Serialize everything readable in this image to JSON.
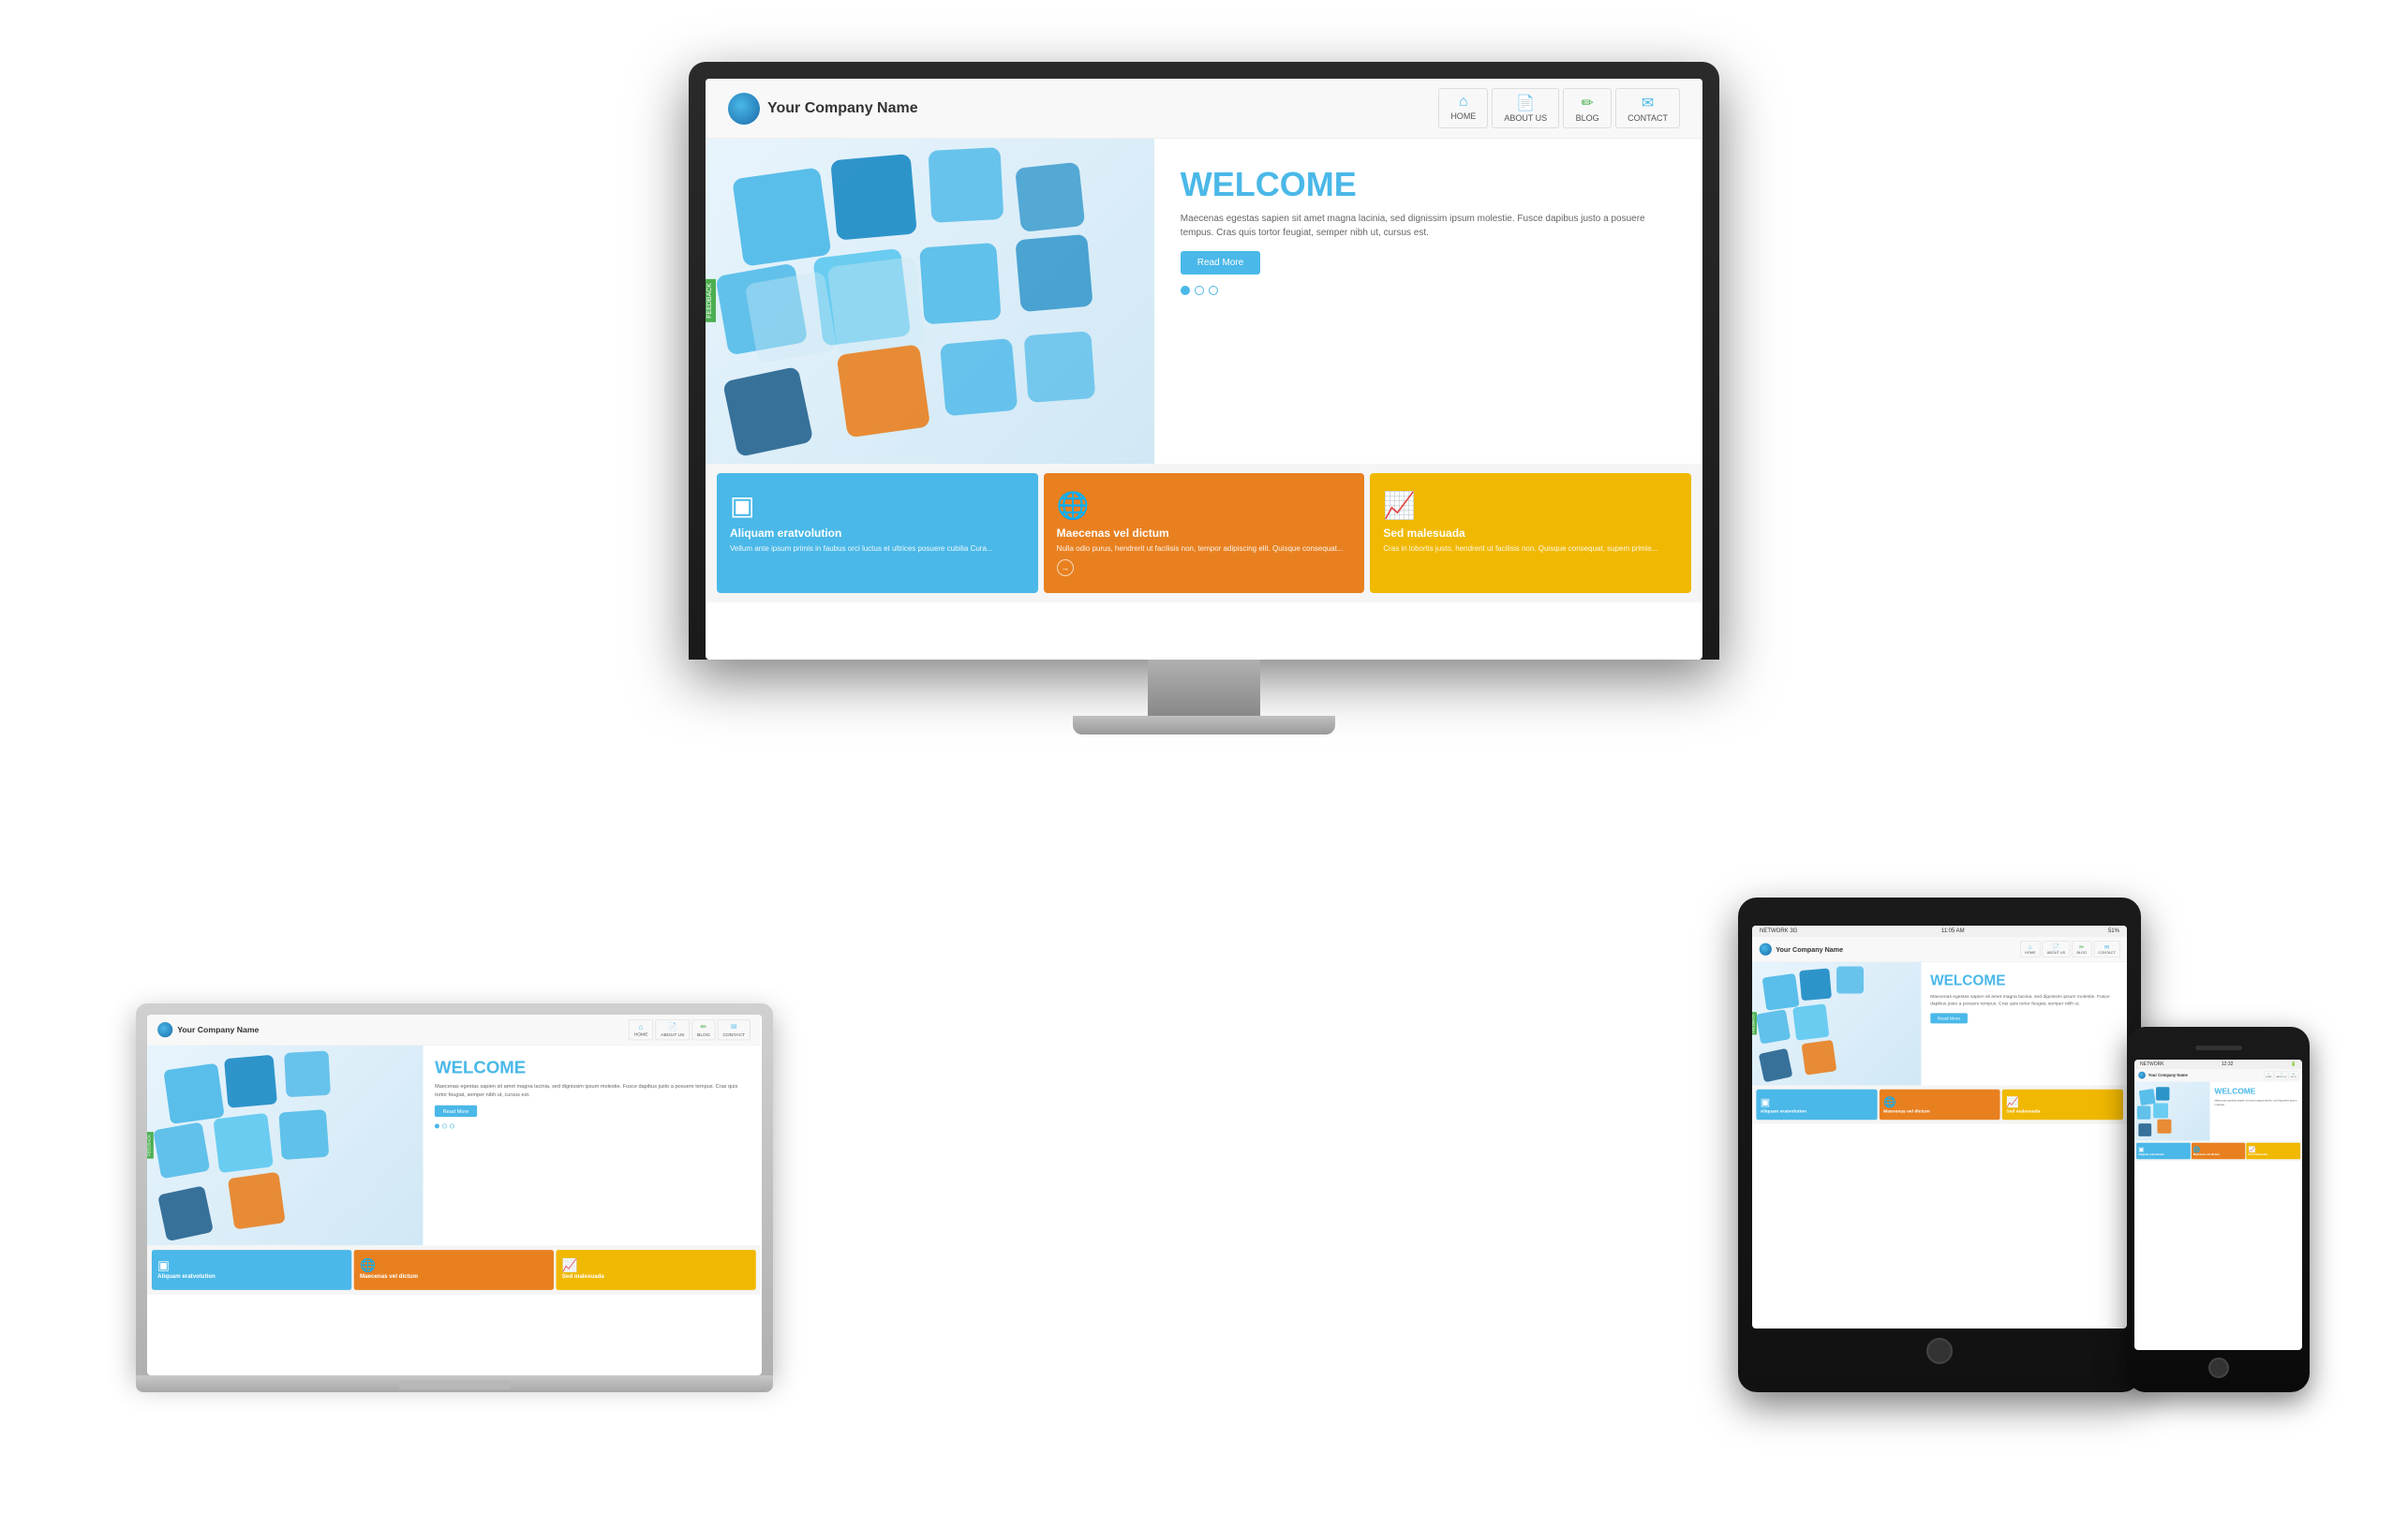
{
  "page": {
    "background": "#ffffff"
  },
  "website": {
    "company_name": "Your Company Name",
    "nav": {
      "home": "HOME",
      "about_us": "ABOUT US",
      "blog": "BLOG",
      "contact": "CONTACT"
    },
    "hero": {
      "title": "WELCOME",
      "body_text": "Maecenas egestas sapien sit amet magna lacinia, sed dignissim ipsum molestie. Fusce dapibus justo a posuere tempus. Cras quis tortor feugiat, semper nibh ut, cursus est.",
      "read_more": "Read More",
      "feedback_label": "FEEDBACK"
    },
    "features": [
      {
        "id": "aliquam",
        "title": "Aliquam eratvolution",
        "text": "Vellum ante ipsum primis in faubus orci luctus et ultrices posuere cubilia Cura...",
        "color": "blue"
      },
      {
        "id": "maecenas",
        "title": "Maecenas vel dictum",
        "text": "Nulla odio purus, hendrerit ut facilisis non, tempor adipiscing elit. Quisque consequat, masa ac varius faucibus, dui iaculis nisl.",
        "color": "orange"
      },
      {
        "id": "sed",
        "title": "Sed malesuada",
        "text": "Cras in lobortis justo, hendrerit ut facilisis non. Quisque consequat, supem primis in faubus.",
        "color": "yellow"
      }
    ]
  },
  "devices": {
    "monitor": {
      "label": "Desktop Monitor"
    },
    "laptop": {
      "label": "Laptop"
    },
    "tablet": {
      "label": "Tablet",
      "network": "NETWORK 3G",
      "time": "11:05 AM",
      "battery": "51%"
    },
    "phone": {
      "label": "Phone",
      "network": "NETWORK",
      "time": "12:32",
      "battery": "▓▓"
    }
  }
}
